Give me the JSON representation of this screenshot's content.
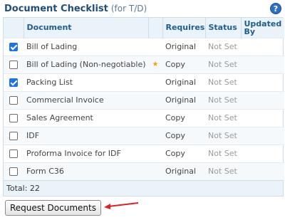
{
  "header": {
    "title": "Document Checklist",
    "subtitle": "(for T/D)",
    "help_icon": "?"
  },
  "table": {
    "columns": {
      "document": "Document",
      "requires": "Requires",
      "status": "Status",
      "updated_by": "Updated By"
    },
    "rows": [
      {
        "checked": true,
        "document": "Bill of Lading",
        "flag": "",
        "requires": "Original",
        "status": "Not Set"
      },
      {
        "checked": false,
        "document": "Bill of Lading (Non-negotiable)",
        "flag": "★",
        "requires": "Copy",
        "status": "Not Set"
      },
      {
        "checked": true,
        "document": "Packing List",
        "flag": "",
        "requires": "Original",
        "status": "Not Set"
      },
      {
        "checked": false,
        "document": "Commercial Invoice",
        "flag": "",
        "requires": "Original",
        "status": "Not Set"
      },
      {
        "checked": false,
        "document": "Sales Agreement",
        "flag": "",
        "requires": "Copy",
        "status": "Not Set"
      },
      {
        "checked": false,
        "document": "IDF",
        "flag": "",
        "requires": "Copy",
        "status": "Not Set"
      },
      {
        "checked": false,
        "document": "Proforma Invoice for IDF",
        "flag": "",
        "requires": "Copy",
        "status": "Not Set"
      },
      {
        "checked": false,
        "document": "Form C36",
        "flag": "",
        "requires": "Original",
        "status": "Not Set"
      }
    ],
    "total": "Total: 22"
  },
  "actions": {
    "request_label": "Request Documents"
  },
  "colors": {
    "header_text": "#1f5e8c",
    "checkbox_checked": "#1a73e8",
    "arrow": "#e02020",
    "star": "#f0a020"
  }
}
